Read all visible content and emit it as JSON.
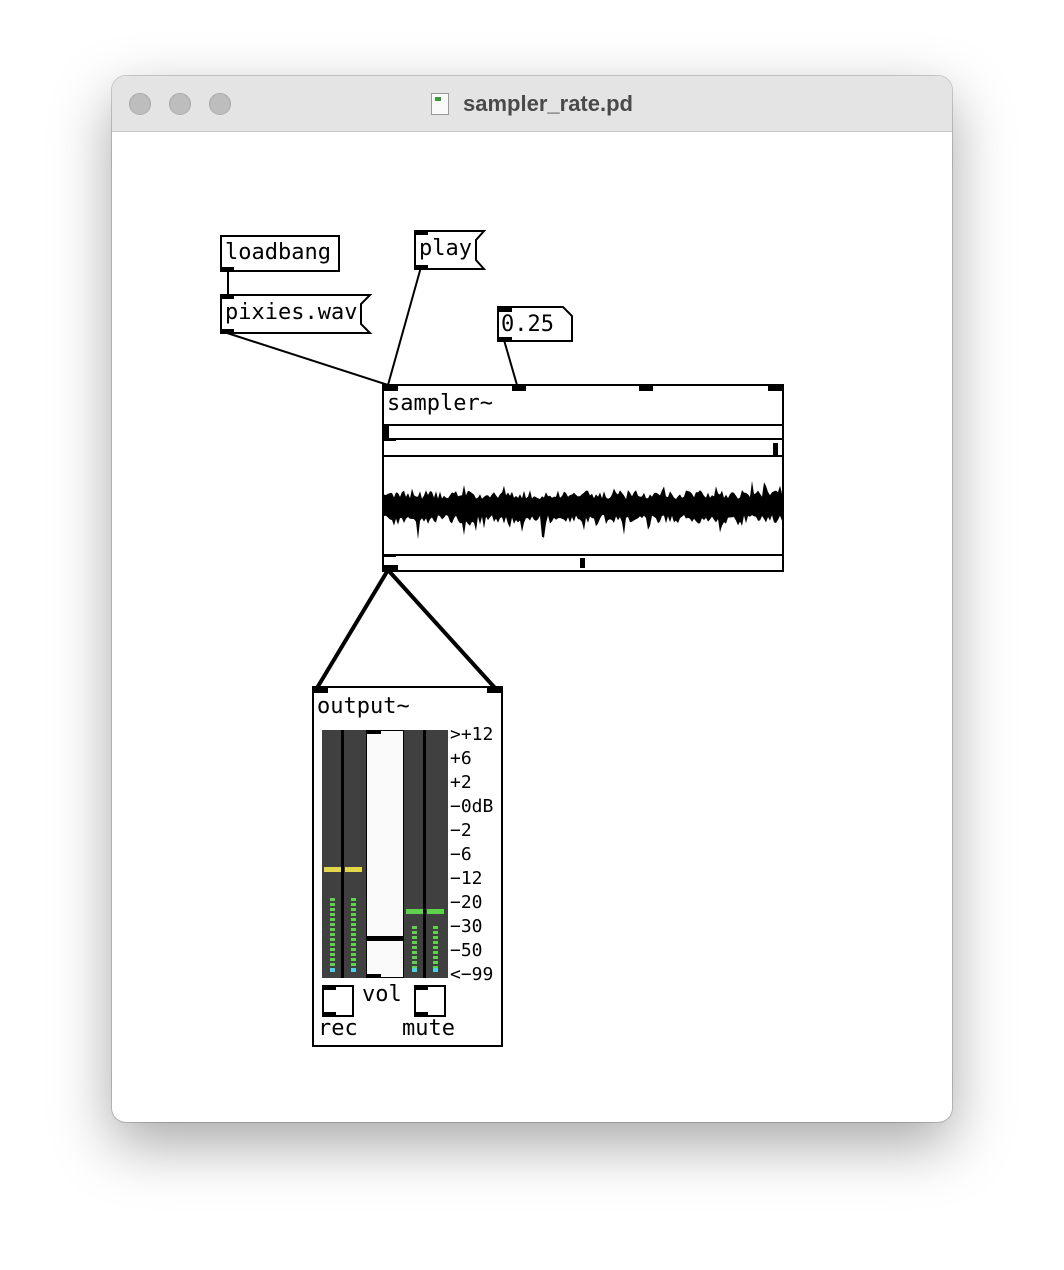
{
  "window": {
    "title": "sampler_rate.pd"
  },
  "objects": {
    "loadbang": "loadbang",
    "sampler": "sampler~",
    "output": "output~"
  },
  "messages": {
    "pixies": "pixies.wav",
    "play": "play"
  },
  "number_box": {
    "value": "0.25"
  },
  "output_panel": {
    "scale": [
      ">+12",
      "+6",
      "+2",
      "−0dB",
      "−2",
      "−6",
      "−12",
      "−20",
      "−30",
      "−50",
      "<−99"
    ],
    "vol_label": "vol",
    "rec_label": "rec",
    "mute_label": "mute"
  },
  "colors": {
    "meter_bg": "#404040",
    "green": "#5ed24a",
    "yellow": "#e2d64a",
    "cyan": "#4ad2e2"
  }
}
